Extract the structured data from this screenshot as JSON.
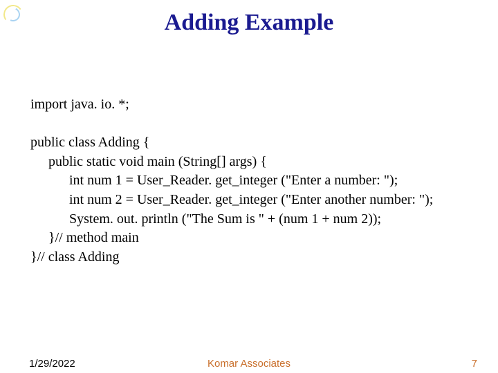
{
  "title": "Adding Example",
  "code": {
    "l1": "import java. io. *;",
    "l2": "public class Adding {",
    "l3": "public static void main (String[] args) {",
    "l4": "int num 1 = User_Reader. get_integer (\"Enter a number: \");",
    "l5": "int num 2 = User_Reader. get_integer (\"Enter another number: \");",
    "l6": "System. out. println (\"The Sum is \" + (num 1 + num 2));",
    "l7": "}// method main",
    "l8": "}// class Adding"
  },
  "footer": {
    "date": "1/29/2022",
    "center": "Komar Associates",
    "page": "7"
  }
}
